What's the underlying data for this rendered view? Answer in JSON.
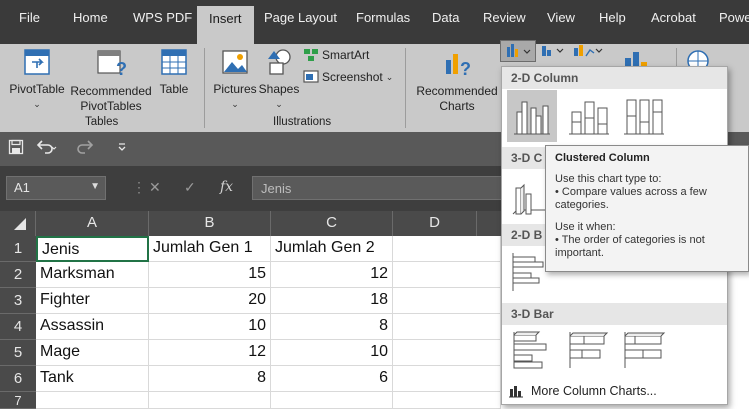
{
  "menu": {
    "tabs": [
      "File",
      "Home",
      "WPS PDF",
      "Insert",
      "Page Layout",
      "Formulas",
      "Data",
      "Review",
      "View",
      "Help",
      "Acrobat",
      "Powe"
    ],
    "active": "Insert"
  },
  "ribbon": {
    "pivottable": "PivotTable",
    "recommended_pivot_1": "Recommended",
    "recommended_pivot_2": "PivotTables",
    "table": "Table",
    "tables_group": "Tables",
    "pictures": "Pictures",
    "shapes": "Shapes",
    "smartart": "SmartArt",
    "screenshot": "Screenshot",
    "illustrations_group": "Illustrations",
    "recommended_charts_1": "Recommended",
    "recommended_charts_2": "Charts"
  },
  "formula_bar": {
    "name_box": "A1",
    "fx": "fx",
    "content": "Jenis"
  },
  "sheet": {
    "columns": [
      "A",
      "B",
      "C",
      "D"
    ],
    "rows": [
      {
        "n": "1",
        "a": "Jenis",
        "b": "Jumlah Gen 1",
        "c": "Jumlah Gen 2"
      },
      {
        "n": "2",
        "a": "Marksman",
        "b": "15",
        "c": "12"
      },
      {
        "n": "3",
        "a": "Fighter",
        "b": "20",
        "c": "18"
      },
      {
        "n": "4",
        "a": "Assassin",
        "b": "10",
        "c": "8"
      },
      {
        "n": "5",
        "a": "Mage",
        "b": "12",
        "c": "10"
      },
      {
        "n": "6",
        "a": "Tank",
        "b": "8",
        "c": "6"
      },
      {
        "n": "7",
        "a": "",
        "b": "",
        "c": ""
      }
    ]
  },
  "dropdown": {
    "sections": {
      "col2d": "2-D Column",
      "col3d": "3-D C",
      "bar2d": "2-D B",
      "bar3d": "3-D Bar"
    },
    "more": "More Column Charts..."
  },
  "tooltip": {
    "title": "Clustered Column",
    "line1": "Use this chart type to:",
    "line2": "• Compare values across a few",
    "line3": "categories.",
    "line4": "Use it when:",
    "line5": "• The order of categories is not",
    "line6": "important."
  },
  "colors": {
    "menubar": "#3a3a3a",
    "ribbon": "#c9c9c9",
    "header": "#4a4a4a",
    "selected_option": "#c7c7c7"
  }
}
